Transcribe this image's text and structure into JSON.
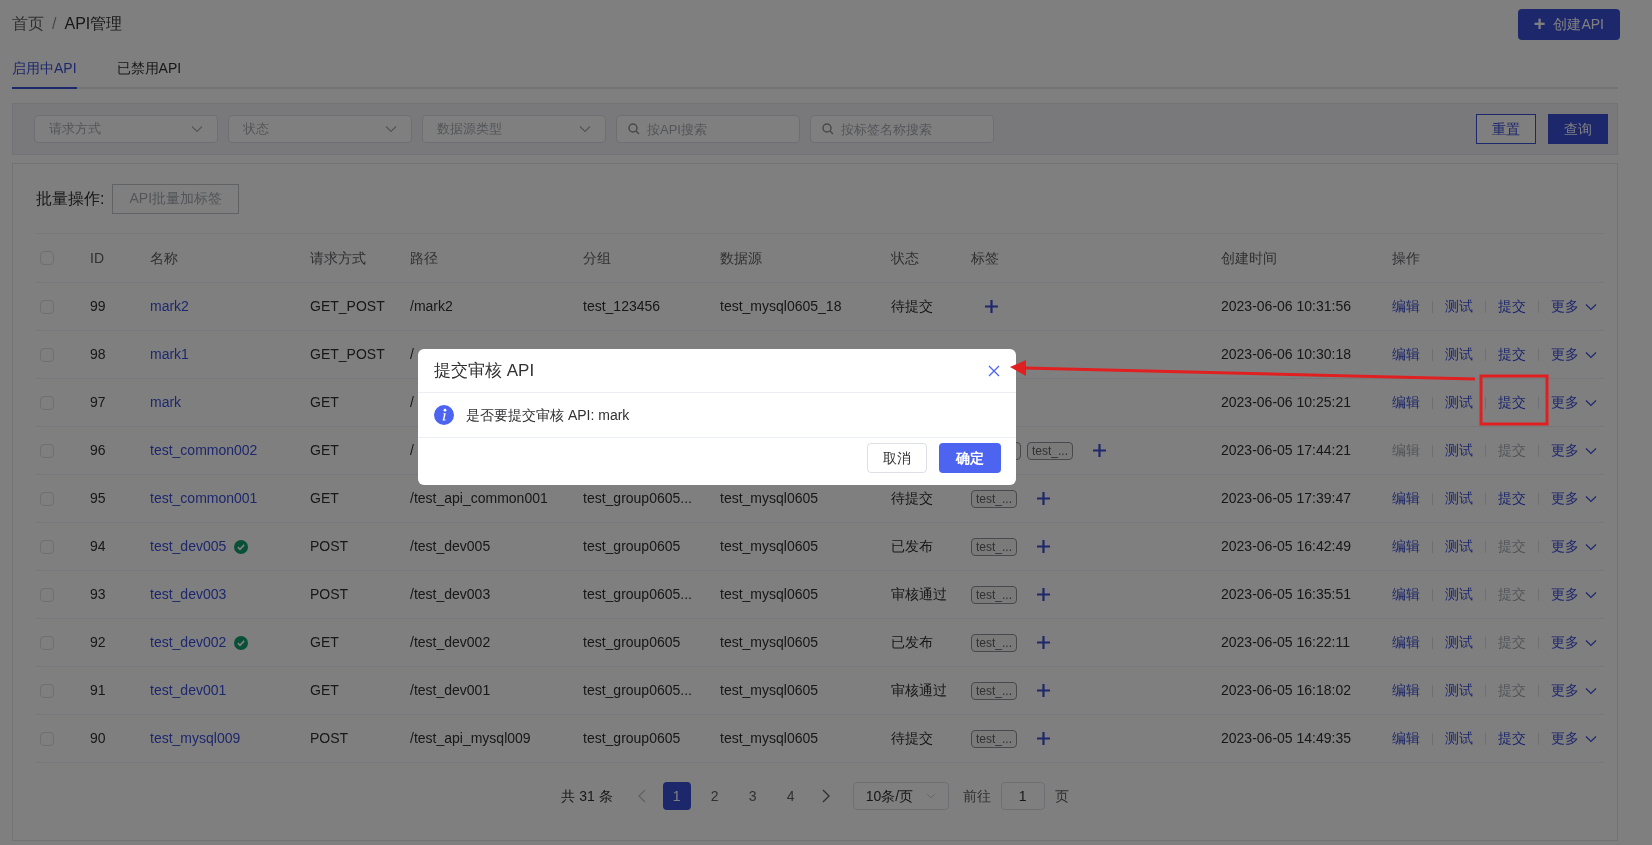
{
  "breadcrumb": [
    "首页",
    "/",
    "API管理"
  ],
  "create_button": {
    "icon": "+",
    "label": "创建API"
  },
  "tabs": [
    {
      "label": "启用中API",
      "selected": true
    },
    {
      "label": "已禁用API",
      "selected": false
    }
  ],
  "filters": [
    {
      "kind": "select",
      "placeholder": "请求方式"
    },
    {
      "kind": "select",
      "placeholder": "状态"
    },
    {
      "kind": "select",
      "placeholder": "数据源类型"
    },
    {
      "kind": "search",
      "placeholder": "按API搜索"
    },
    {
      "kind": "search",
      "placeholder": "按标签名称搜索"
    }
  ],
  "filter_buttons": [
    {
      "label": "重置",
      "primary": false
    },
    {
      "label": "查询",
      "primary": true
    }
  ],
  "batch": {
    "label": "批量操作:",
    "button": "API批量加标签"
  },
  "table": {
    "all_checked": false,
    "columns": [
      "ID",
      "名称",
      "请求方式",
      "路径",
      "分组",
      "数据源",
      "状态",
      "标签",
      "创建时间",
      "操作"
    ],
    "rows": [
      {
        "checked": false,
        "id": "99",
        "name": "mark2",
        "verified": false,
        "method": "GET_POST",
        "path": "/mark2",
        "group": "test_123456",
        "datasource": "test_mysql0605_18",
        "status": "待提交",
        "tags": [],
        "add_tag": true,
        "created": "2023-06-06 10:31:56",
        "actions": [
          {
            "label": "编辑",
            "disabled": false
          },
          {
            "label": "测试",
            "disabled": false
          },
          {
            "label": "提交",
            "disabled": false
          }
        ],
        "more": "更多"
      },
      {
        "checked": false,
        "id": "98",
        "name": "mark1",
        "verified": false,
        "method": "GET_POST",
        "path": "/",
        "tags": [],
        "add_tag": false,
        "created": "2023-06-06 10:30:18",
        "actions": [
          {
            "label": "编辑",
            "disabled": false
          },
          {
            "label": "测试",
            "disabled": false
          },
          {
            "label": "提交",
            "disabled": false
          }
        ],
        "more": "更多"
      },
      {
        "checked": false,
        "id": "97",
        "name": "mark",
        "verified": false,
        "method": "GET",
        "path": "/",
        "tags": [],
        "created": "2023-06-06 10:25:21",
        "actions": [
          {
            "label": "编辑",
            "disabled": false
          },
          {
            "label": "测试",
            "disabled": false
          },
          {
            "label": "提交",
            "disabled": false
          }
        ],
        "more": "更多"
      },
      {
        "checked": false,
        "id": "96",
        "name": "test_common002",
        "verified": false,
        "method": "GET",
        "path": "/",
        "tags": [
          {
            "kind": "covered"
          },
          {
            "kind": "tag",
            "label": "test_..."
          }
        ],
        "add_tag": true,
        "created": "2023-06-05 17:44:21",
        "actions": [
          {
            "label": "编辑",
            "disabled": true
          },
          {
            "label": "测试",
            "disabled": false
          },
          {
            "label": "提交",
            "disabled": true
          }
        ],
        "more": "更多"
      },
      {
        "checked": false,
        "id": "95",
        "name": "test_common001",
        "verified": false,
        "method": "GET",
        "path": "/test_api_common001",
        "group": "test_group0605...",
        "datasource": "test_mysql0605",
        "status": "待提交",
        "tags": [
          {
            "kind": "tag",
            "label": "test_..."
          }
        ],
        "add_tag": true,
        "created": "2023-06-05 17:39:47",
        "actions": [
          {
            "label": "编辑",
            "disabled": false
          },
          {
            "label": "测试",
            "disabled": false
          },
          {
            "label": "提交",
            "disabled": false
          }
        ],
        "more": "更多"
      },
      {
        "checked": false,
        "id": "94",
        "name": "test_dev005",
        "verified": true,
        "method": "POST",
        "path": "/test_dev005",
        "group": "test_group0605",
        "datasource": "test_mysql0605",
        "status": "已发布",
        "tags": [
          {
            "kind": "tag",
            "label": "test_..."
          }
        ],
        "add_tag": true,
        "created": "2023-06-05 16:42:49",
        "actions": [
          {
            "label": "编辑",
            "disabled": false
          },
          {
            "label": "测试",
            "disabled": false
          },
          {
            "label": "提交",
            "disabled": true
          }
        ],
        "more": "更多"
      },
      {
        "checked": false,
        "id": "93",
        "name": "test_dev003",
        "verified": false,
        "method": "POST",
        "path": "/test_dev003",
        "group": "test_group0605...",
        "datasource": "test_mysql0605",
        "status": "审核通过",
        "tags": [
          {
            "kind": "tag",
            "label": "test_..."
          }
        ],
        "add_tag": true,
        "created": "2023-06-05 16:35:51",
        "actions": [
          {
            "label": "编辑",
            "disabled": false
          },
          {
            "label": "测试",
            "disabled": false
          },
          {
            "label": "提交",
            "disabled": true
          }
        ],
        "more": "更多"
      },
      {
        "checked": false,
        "id": "92",
        "name": "test_dev002",
        "verified": true,
        "method": "GET",
        "path": "/test_dev002",
        "group": "test_group0605",
        "datasource": "test_mysql0605",
        "status": "已发布",
        "tags": [
          {
            "kind": "tag",
            "label": "test_..."
          }
        ],
        "add_tag": true,
        "created": "2023-06-05 16:22:11",
        "actions": [
          {
            "label": "编辑",
            "disabled": false
          },
          {
            "label": "测试",
            "disabled": false
          },
          {
            "label": "提交",
            "disabled": true
          }
        ],
        "more": "更多"
      },
      {
        "checked": false,
        "id": "91",
        "name": "test_dev001",
        "verified": false,
        "method": "GET",
        "path": "/test_dev001",
        "group": "test_group0605...",
        "datasource": "test_mysql0605",
        "status": "审核通过",
        "tags": [
          {
            "kind": "tag",
            "label": "test_..."
          }
        ],
        "add_tag": true,
        "created": "2023-06-05 16:18:02",
        "actions": [
          {
            "label": "编辑",
            "disabled": false
          },
          {
            "label": "测试",
            "disabled": false
          },
          {
            "label": "提交",
            "disabled": true
          }
        ],
        "more": "更多"
      },
      {
        "checked": false,
        "id": "90",
        "name": "test_mysql009",
        "verified": false,
        "method": "POST",
        "path": "/test_api_mysql009",
        "group": "test_group0605",
        "datasource": "test_mysql0605",
        "status": "待提交",
        "tags": [
          {
            "kind": "tag",
            "label": "test_..."
          }
        ],
        "add_tag": true,
        "created": "2023-06-05 14:49:35",
        "actions": [
          {
            "label": "编辑",
            "disabled": false
          },
          {
            "label": "测试",
            "disabled": false
          },
          {
            "label": "提交",
            "disabled": false
          }
        ],
        "more": "更多"
      }
    ]
  },
  "pagination": {
    "total": "共 31 条",
    "pages": [
      {
        "label": "1",
        "selected": true
      },
      {
        "label": "2",
        "selected": false
      },
      {
        "label": "3",
        "selected": false
      },
      {
        "label": "4",
        "selected": false
      }
    ],
    "page_size": "10条/页",
    "goto_label": "前往",
    "goto_value": "1",
    "goto_suffix": "页"
  },
  "dialog": {
    "title": "提交审核 API",
    "message": "是否要提交审核 API: mark",
    "buttons": [
      {
        "label": "取消",
        "primary": false
      },
      {
        "label": "确定",
        "primary": true
      }
    ]
  }
}
